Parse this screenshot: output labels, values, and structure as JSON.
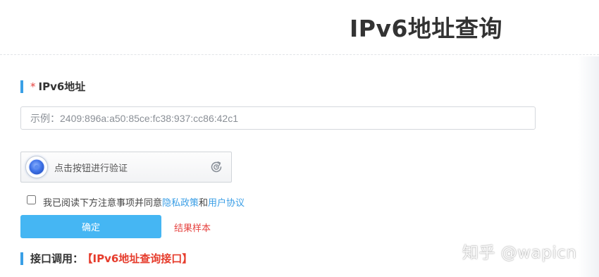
{
  "header": {
    "title": "IPv6地址查询"
  },
  "ipv6_section": {
    "required_mark": "*",
    "label": "IPv6地址",
    "input_value": "",
    "input_placeholder": "示例：2409:896a:a50:85ce:fc38:937:cc86:42c1"
  },
  "captcha": {
    "text": "点击按钮进行验证",
    "icon": "refresh-icon"
  },
  "agreement": {
    "checked": false,
    "prefix": "我已阅读下方注意事项并同意",
    "privacy_link": "隐私政策",
    "connector": "和",
    "terms_link": "用户协议"
  },
  "actions": {
    "confirm_label": "确定",
    "sample_link": "结果样本"
  },
  "api_section": {
    "label": "接口调用：",
    "link": "【IPv6地址查询接口】"
  },
  "watermark": {
    "text": "知乎 @wapicn"
  },
  "colors": {
    "accent": "#45b6f3",
    "section_bar": "#3aa0e6",
    "required": "#e64340",
    "link": "#3a9ee6",
    "api_link": "#e63c2c"
  }
}
